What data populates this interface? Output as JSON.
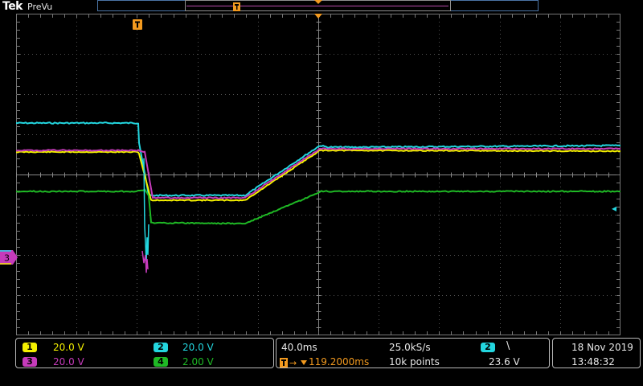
{
  "header": {
    "brand": "Tek",
    "mode": "PreVu"
  },
  "colors": {
    "ch1": "#f4f000",
    "ch2": "#23d6df",
    "ch3": "#c63bbb",
    "ch4": "#1fb925",
    "trigger": "#f39a1f",
    "grid": "#505050"
  },
  "channels": [
    {
      "number": "1",
      "scale": "20.0 V"
    },
    {
      "number": "2",
      "scale": "20.0 V"
    },
    {
      "number": "3",
      "scale": "20.0 V"
    },
    {
      "number": "4",
      "scale": "2.00 V"
    }
  ],
  "markers": {
    "trigger_label": "T",
    "ch3_marker": "3",
    "ch2_level_marker": "◂"
  },
  "timebase": {
    "horizontal_scale": "40.0ms",
    "sample_rate": "25.0kS/s",
    "trigger_position": "119.2000ms",
    "record_length": "10k points"
  },
  "trigger": {
    "source": "2",
    "slope_symbol": "\\",
    "level": "23.6 V"
  },
  "datetime": {
    "date": "18 Nov 2019",
    "time": "13:48:32"
  }
}
